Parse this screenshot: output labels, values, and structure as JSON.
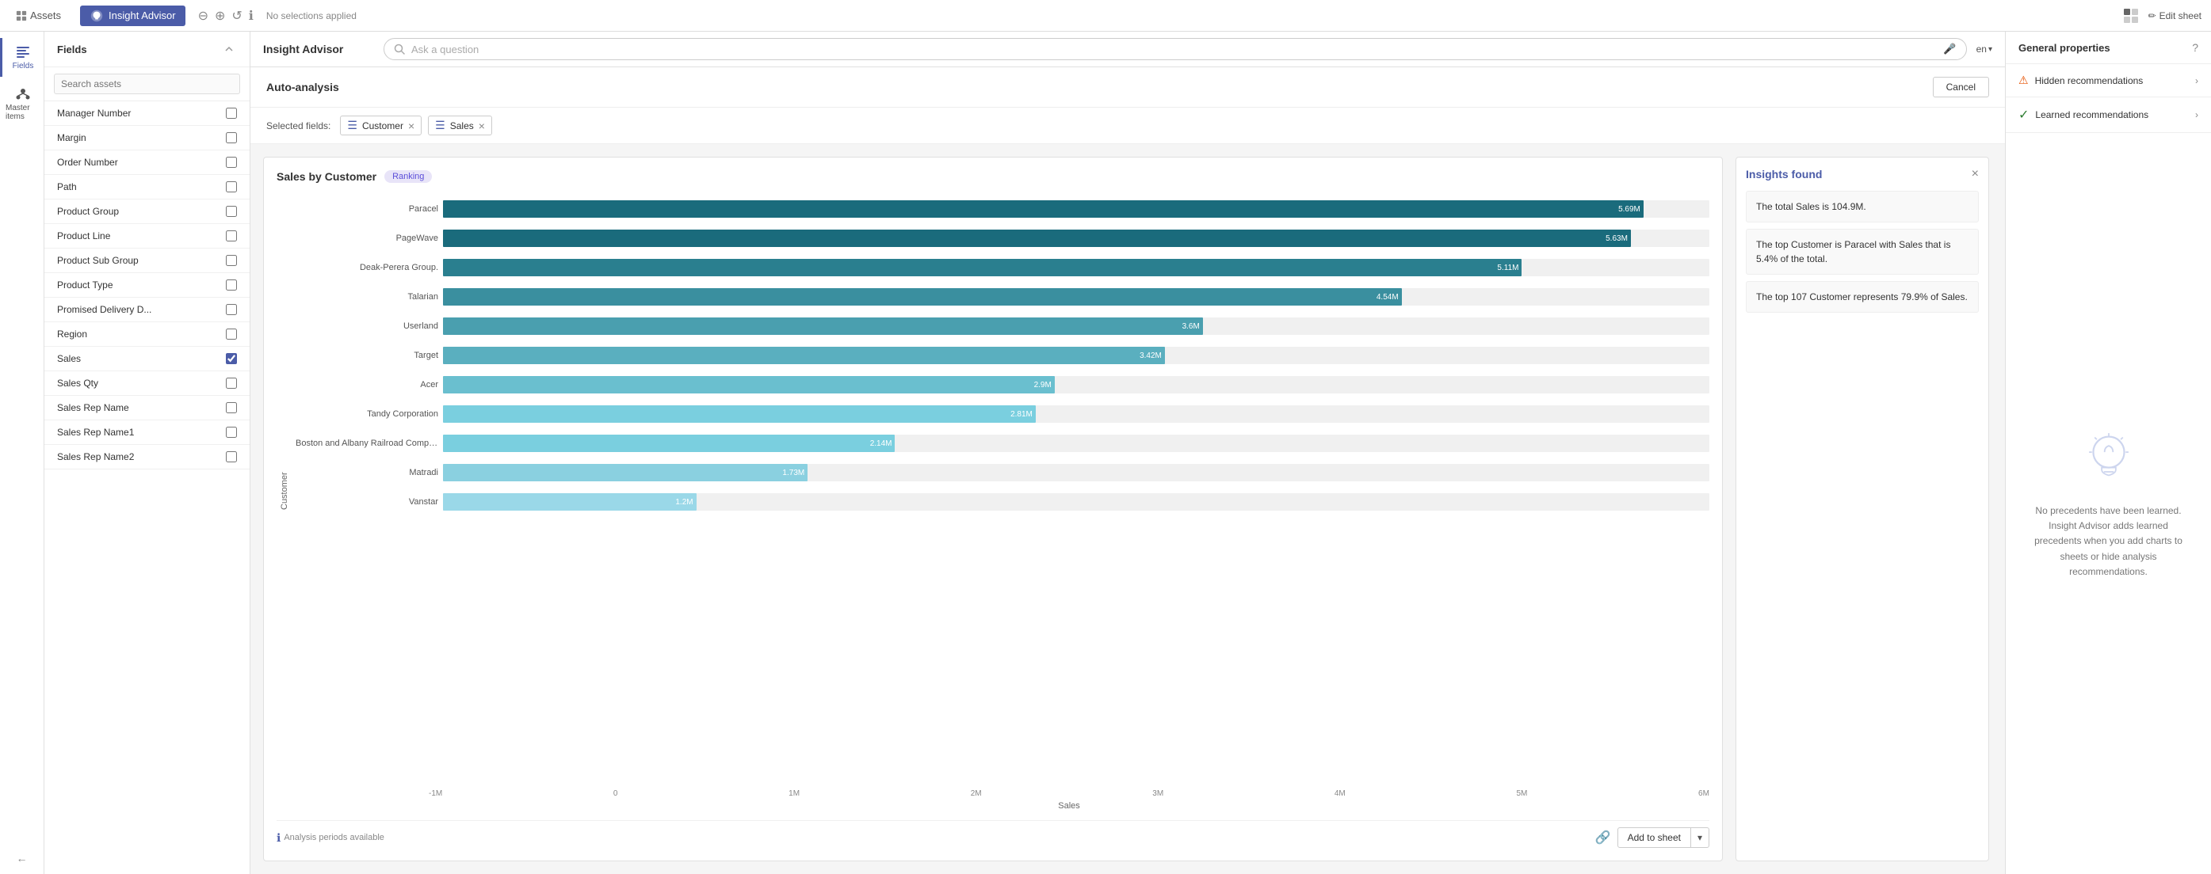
{
  "topbar": {
    "assets_label": "Assets",
    "insight_label": "Insight Advisor",
    "no_selections": "No selections applied",
    "edit_sheet": "Edit sheet"
  },
  "search_bar": {
    "title": "Insight Advisor",
    "placeholder": "Ask a question",
    "language": "en"
  },
  "fields_panel": {
    "title": "Fields",
    "search_placeholder": "Search assets",
    "items": [
      {
        "label": "Manager Number",
        "checked": false
      },
      {
        "label": "Margin",
        "checked": false
      },
      {
        "label": "Order Number",
        "checked": false
      },
      {
        "label": "Path",
        "checked": false
      },
      {
        "label": "Product Group",
        "checked": false
      },
      {
        "label": "Product Line",
        "checked": false
      },
      {
        "label": "Product Sub Group",
        "checked": false
      },
      {
        "label": "Product Type",
        "checked": false
      },
      {
        "label": "Promised Delivery D...",
        "checked": false
      },
      {
        "label": "Region",
        "checked": false
      },
      {
        "label": "Sales",
        "checked": true
      },
      {
        "label": "Sales Qty",
        "checked": false
      },
      {
        "label": "Sales Rep Name",
        "checked": false
      },
      {
        "label": "Sales Rep Name1",
        "checked": false
      },
      {
        "label": "Sales Rep Name2",
        "checked": false
      }
    ]
  },
  "auto_analysis": {
    "title": "Auto-analysis",
    "cancel_label": "Cancel",
    "selected_fields_label": "Selected fields:",
    "field_tags": [
      {
        "label": "Customer",
        "icon": "☰"
      },
      {
        "label": "Sales",
        "icon": "☰"
      }
    ]
  },
  "chart": {
    "title": "Sales by Customer",
    "badge": "Ranking",
    "y_axis_label": "Customer",
    "x_axis_label": "Sales",
    "x_ticks": [
      "-1M",
      "0",
      "1M",
      "2M",
      "3M",
      "4M",
      "5M",
      "6M"
    ],
    "bars": [
      {
        "label": "Paracel",
        "value": "5.69M",
        "pct": 94.8,
        "color": "#1a6b7c"
      },
      {
        "label": "PageWave",
        "value": "5.63M",
        "pct": 93.8,
        "color": "#1a6b7c"
      },
      {
        "label": "Deak-Perera Group.",
        "value": "5.11M",
        "pct": 85.2,
        "color": "#2a7f8f"
      },
      {
        "label": "Talarian",
        "value": "4.54M",
        "pct": 75.7,
        "color": "#3a8f9f"
      },
      {
        "label": "Userland",
        "value": "3.6M",
        "pct": 60.0,
        "color": "#4a9faf"
      },
      {
        "label": "Target",
        "value": "3.42M",
        "pct": 57.0,
        "color": "#5aafbf"
      },
      {
        "label": "Acer",
        "value": "2.9M",
        "pct": 48.3,
        "color": "#6abfcf"
      },
      {
        "label": "Tandy Corporation",
        "value": "2.81M",
        "pct": 46.8,
        "color": "#7acfdf"
      },
      {
        "label": "Boston and Albany Railroad Company",
        "value": "2.14M",
        "pct": 35.7,
        "color": "#7acfdf"
      },
      {
        "label": "Matradi",
        "value": "1.73M",
        "pct": 28.8,
        "color": "#8ad0e0"
      },
      {
        "label": "Vanstar",
        "value": "1.2M",
        "pct": 20.0,
        "color": "#9ad8e8"
      }
    ],
    "footer": {
      "periods_label": "Analysis periods available",
      "add_to_sheet": "Add to sheet"
    }
  },
  "insights": {
    "title": "Insights found",
    "cards": [
      {
        "text": "The total Sales is 104.9M."
      },
      {
        "text": "The top Customer is Paracel with Sales that is 5.4% of the total."
      },
      {
        "text": "The top 107 Customer represents 79.9% of Sales."
      }
    ]
  },
  "right_panel": {
    "title": "General properties",
    "sections": [
      {
        "label": "Hidden recommendations",
        "type": "hidden",
        "icon": "warning"
      },
      {
        "label": "Learned recommendations",
        "type": "learned",
        "icon": "check"
      }
    ],
    "lightbulb_text": "No precedents have been learned. Insight Advisor adds learned precedents when you add charts to sheets or hide analysis recommendations."
  },
  "icon_sidebar": {
    "items": [
      {
        "label": "Fields",
        "active": true
      },
      {
        "label": "Master items",
        "active": false
      }
    ]
  }
}
